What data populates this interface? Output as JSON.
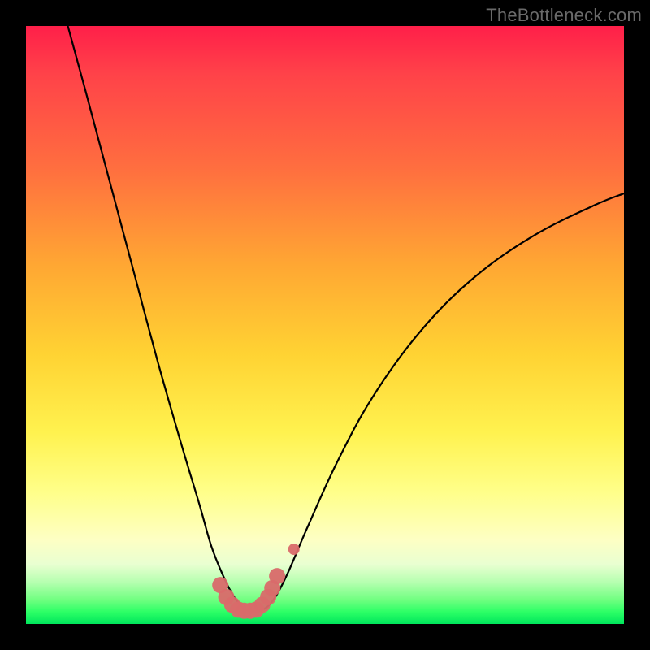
{
  "watermark": "TheBottleneck.com",
  "colors": {
    "frame_bg": "#000000",
    "curve_stroke": "#000000",
    "marker_fill": "#d96a6a",
    "marker_stroke": "#d96a6a",
    "gradient_top": "#ff1f49",
    "gradient_bottom": "#00e65c",
    "watermark_text": "#6a6a6a"
  },
  "chart_data": {
    "type": "line",
    "title": "",
    "xlabel": "",
    "ylabel": "",
    "xlim": [
      0,
      100
    ],
    "ylim": [
      0,
      100
    ],
    "grid": false,
    "legend": false,
    "annotations": [],
    "series": [
      {
        "name": "bottleneck-curve",
        "x": [
          7,
          10,
          14,
          18,
          22,
          26,
          29,
          31,
          33,
          34.5,
          36,
          37.5,
          39,
          40.5,
          42,
          44,
          47,
          52,
          58,
          66,
          75,
          85,
          95,
          100
        ],
        "y": [
          100,
          89,
          74,
          59,
          44,
          30,
          20,
          13,
          8,
          5,
          3,
          2.2,
          2.2,
          3,
          5,
          9,
          16,
          27,
          38,
          49,
          58,
          65,
          70,
          72
        ]
      }
    ],
    "markers": [
      {
        "name": "highlight-pink",
        "shape": "round-dots",
        "x": [
          32.5,
          33.5,
          34.5,
          35.5,
          36.5,
          37.5,
          38.5,
          39.5,
          40.5,
          41.2,
          42.0
        ],
        "y": [
          6.5,
          4.5,
          3.2,
          2.4,
          2.2,
          2.2,
          2.4,
          3.2,
          4.5,
          6.0,
          8.0
        ],
        "radius_px": 10
      },
      {
        "name": "highlight-pink-detached",
        "shape": "round-dots",
        "x": [
          44.8
        ],
        "y": [
          12.5
        ],
        "radius_px": 7
      }
    ]
  }
}
